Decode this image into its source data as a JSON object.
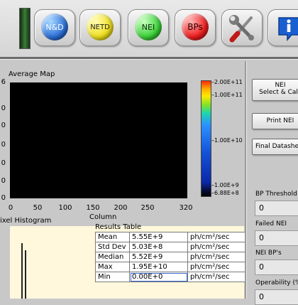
{
  "toolbar": {
    "buttons": [
      {
        "label": "N&D",
        "color": "#2d72d9"
      },
      {
        "label": "NETD",
        "color": "#f0e020"
      },
      {
        "label": "NEI",
        "color": "#3bd238"
      },
      {
        "label": "BPs",
        "color": "#ef1f1f"
      }
    ],
    "tools_icon": "wrench-screwdriver-icon",
    "info_icon": "info-icon"
  },
  "average_map": {
    "title": "Average Map",
    "y_ticks": [
      "6",
      "0",
      "0",
      "0",
      "0",
      "0",
      "0"
    ],
    "x_ticks": [
      "0",
      "50",
      "100",
      "150",
      "200",
      "250",
      "320"
    ],
    "x_label": "Column",
    "colorbar_labels": [
      "2.00E+11",
      "1.00E+11",
      "1.00E+10",
      "1.00E+9",
      "6.88E+8"
    ]
  },
  "histogram": {
    "title": "ixel Histogram"
  },
  "results_table": {
    "title": "Results Table",
    "rows": [
      {
        "name": "Mean",
        "value": "5.55E+9",
        "unit": "ph/cm²/sec"
      },
      {
        "name": "Std Dev",
        "value": "5.03E+8",
        "unit": "ph/cm²/sec"
      },
      {
        "name": "Median",
        "value": "5.52E+9",
        "unit": "ph/cm²/sec"
      },
      {
        "name": "Max",
        "value": "1.95E+10",
        "unit": "ph/cm²/sec"
      },
      {
        "name": "Min",
        "value": "0.00E+0",
        "unit": "ph/cm²/sec"
      }
    ]
  },
  "right_panel": {
    "nei_button_line1": "NEI",
    "nei_button_line2": "Select & Calc",
    "print_button": "Print NEI",
    "datasheet_button": "Final Datashe",
    "fields": [
      {
        "label": "BP Threshold",
        "value": "0"
      },
      {
        "label": "Failed NEI",
        "value": "0"
      },
      {
        "label": "NEI BP's",
        "value": "0"
      },
      {
        "label": "Operability (%",
        "value": "0"
      }
    ]
  }
}
